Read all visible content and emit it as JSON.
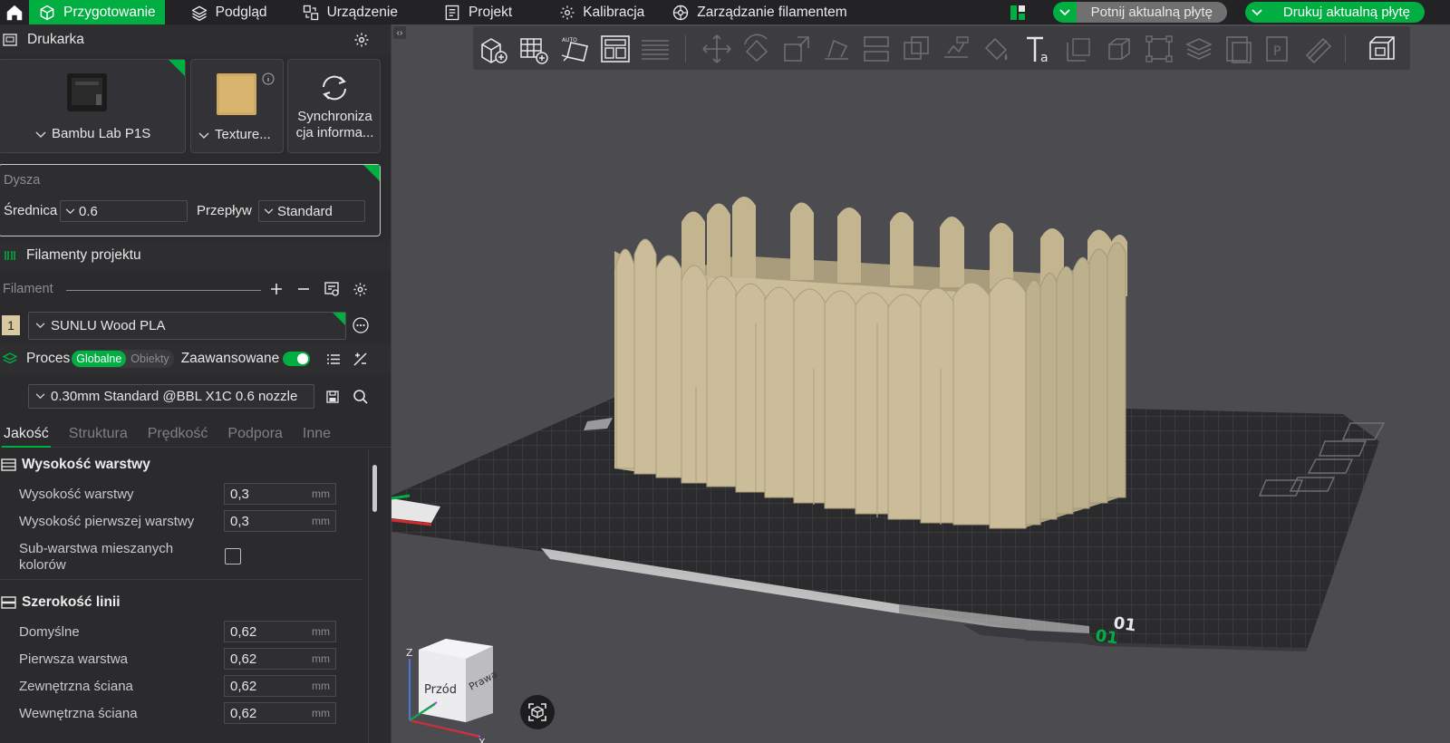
{
  "tabs": [
    {
      "label": "Przygotowanie",
      "icon": "cube-icon",
      "active": true
    },
    {
      "label": "Podgląd",
      "icon": "layers-icon",
      "active": false
    },
    {
      "label": "Urządzenie",
      "icon": "device-icon",
      "active": false
    },
    {
      "label": "Projekt",
      "icon": "project-icon",
      "active": false
    },
    {
      "label": "Kalibracja",
      "icon": "gear-icon",
      "active": false
    },
    {
      "label": "Zarządzanie filamentem",
      "icon": "spool-icon",
      "active": false
    }
  ],
  "actions": {
    "slice_label": "Potnij aktualną płytę",
    "print_label": "Drukuj aktualną płytę"
  },
  "printer": {
    "section_title": "Drukarka",
    "printer_name": "Bambu Lab P1S",
    "plate_name": "Texture...",
    "sync_label": "Synchroniza cja informa..."
  },
  "nozzle": {
    "section_title": "Dysza",
    "diameter_label": "Średnica",
    "diameter_value": "0.6",
    "flow_label": "Przepływ",
    "flow_value": "Standard"
  },
  "filaments": {
    "section_title": "Filamenty projektu",
    "subheader": "Filament",
    "items": [
      {
        "index": "1",
        "name": "SUNLU Wood PLA",
        "color": "#d9c9a3"
      }
    ]
  },
  "process": {
    "section_title": "Proces",
    "toggle_global": "Globalne",
    "toggle_objects": "Obiekty",
    "advanced_label": "Zaawansowane",
    "profile": "0.30mm Standard @BBL X1C 0.6 nozzle"
  },
  "param_tabs": [
    "Jakość",
    "Struktura",
    "Prędkość",
    "Podpora",
    "Inne"
  ],
  "quality": {
    "layer_group": "Wysokość warstwy",
    "layer_height_label": "Wysokość warstwy",
    "layer_height_value": "0,3",
    "first_layer_label": "Wysokość pierwszej warstwy",
    "first_layer_value": "0,3",
    "sublayer_label_1": "Sub-warstwa mieszanych",
    "sublayer_label_2": "kolorów",
    "unit": "mm",
    "width_group": "Szerokość linii",
    "widths": [
      {
        "label": "Domyślne",
        "value": "0,62"
      },
      {
        "label": "Pierwsza warstwa",
        "value": "0,62"
      },
      {
        "label": "Zewnętrzna ściana",
        "value": "0,62"
      },
      {
        "label": "Wewnętrzna ściana",
        "value": "0,62"
      }
    ]
  },
  "viewport": {
    "cube_front": "Przód",
    "cube_right": "Prawa",
    "plate_number": "01",
    "model_color": "#cbbd99",
    "accent": "#00ae42"
  }
}
